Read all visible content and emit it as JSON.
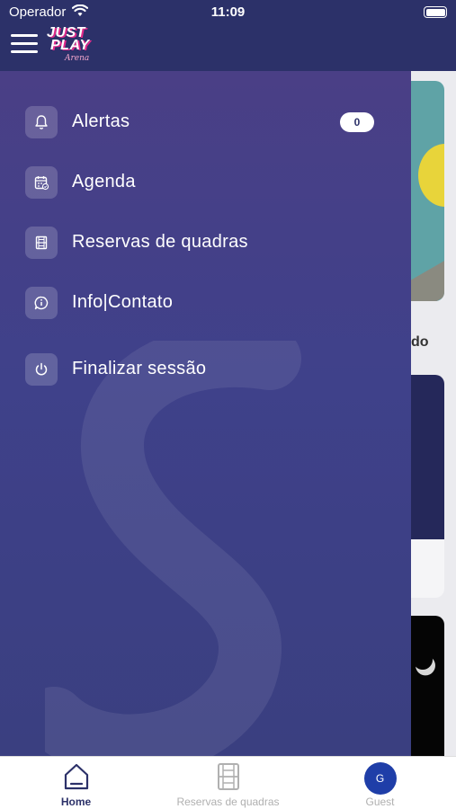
{
  "status_bar": {
    "carrier": "Operador",
    "time": "11:09"
  },
  "header": {
    "menu_icon": "hamburger-icon",
    "logo": {
      "line1": "JUST",
      "line2": "PLAY",
      "line3": "Arena"
    }
  },
  "drawer": {
    "items": [
      {
        "label": "Alertas",
        "icon": "bell-icon",
        "badge": "0"
      },
      {
        "label": "Agenda",
        "icon": "calendar-icon"
      },
      {
        "label": "Reservas de quadras",
        "icon": "court-icon"
      },
      {
        "label": "Info|Contato",
        "icon": "info-chat-icon"
      },
      {
        "label": "Finalizar sessão",
        "icon": "power-icon"
      }
    ]
  },
  "background": {
    "peek_text": "do"
  },
  "tab_bar": {
    "tabs": [
      {
        "label": "Home",
        "icon": "home-icon",
        "active": true
      },
      {
        "label": "Reservas de quadras",
        "icon": "court-icon",
        "active": false
      },
      {
        "label": "Guest",
        "icon": "avatar",
        "avatar_initial": "G",
        "active": false
      }
    ]
  },
  "colors": {
    "primary": "#2c3169",
    "drawer": "#433f88",
    "avatar": "#1f3ea8",
    "accent_pink": "#e0288a"
  }
}
